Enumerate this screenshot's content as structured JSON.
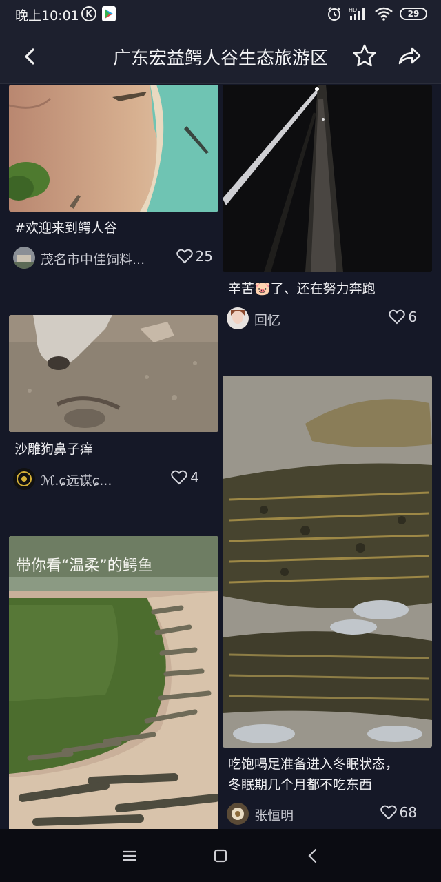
{
  "status_bar": {
    "time": "晚上10:01",
    "notification_icons": [
      "k-circle-icon",
      "google-play-icon"
    ],
    "system_icons": [
      "alarm-icon",
      "hd-signal-icon",
      "wifi-icon"
    ],
    "battery": "29"
  },
  "header": {
    "title": "广东宏益鳄人谷生态旅游区",
    "back_icon": "back-arrow-icon",
    "favorite_icon": "star-outline-icon",
    "share_icon": "share-icon"
  },
  "feed": {
    "left": [
      {
        "caption": "#欢迎来到鳄人谷",
        "author": "茂名市中佳饲料...",
        "likes": "25"
      },
      {
        "caption": "沙雕狗鼻子痒",
        "author": "ℳ.ɕ远谋ɕ...",
        "likes": "4"
      },
      {
        "caption_on_image": "带你看“温柔”的鳄鱼"
      }
    ],
    "right": [
      {
        "caption": "辛苦🐷了、还在努力奔跑",
        "author": "回忆",
        "likes": "6"
      },
      {
        "caption_line1": "吃饱喝足准备进入冬眠状态，",
        "caption_line2": "冬眠期几个月都不吃东西",
        "author": "张恒明",
        "likes": "68"
      }
    ]
  },
  "nav_bar": {
    "icons": [
      "menu-icon",
      "home-square-icon",
      "back-chevron-icon"
    ]
  },
  "colors": {
    "background": "#151827",
    "bar": "#1d202e",
    "nav": "#0b0c12",
    "text": "#f0f0f3",
    "muted": "#c9cad2"
  }
}
